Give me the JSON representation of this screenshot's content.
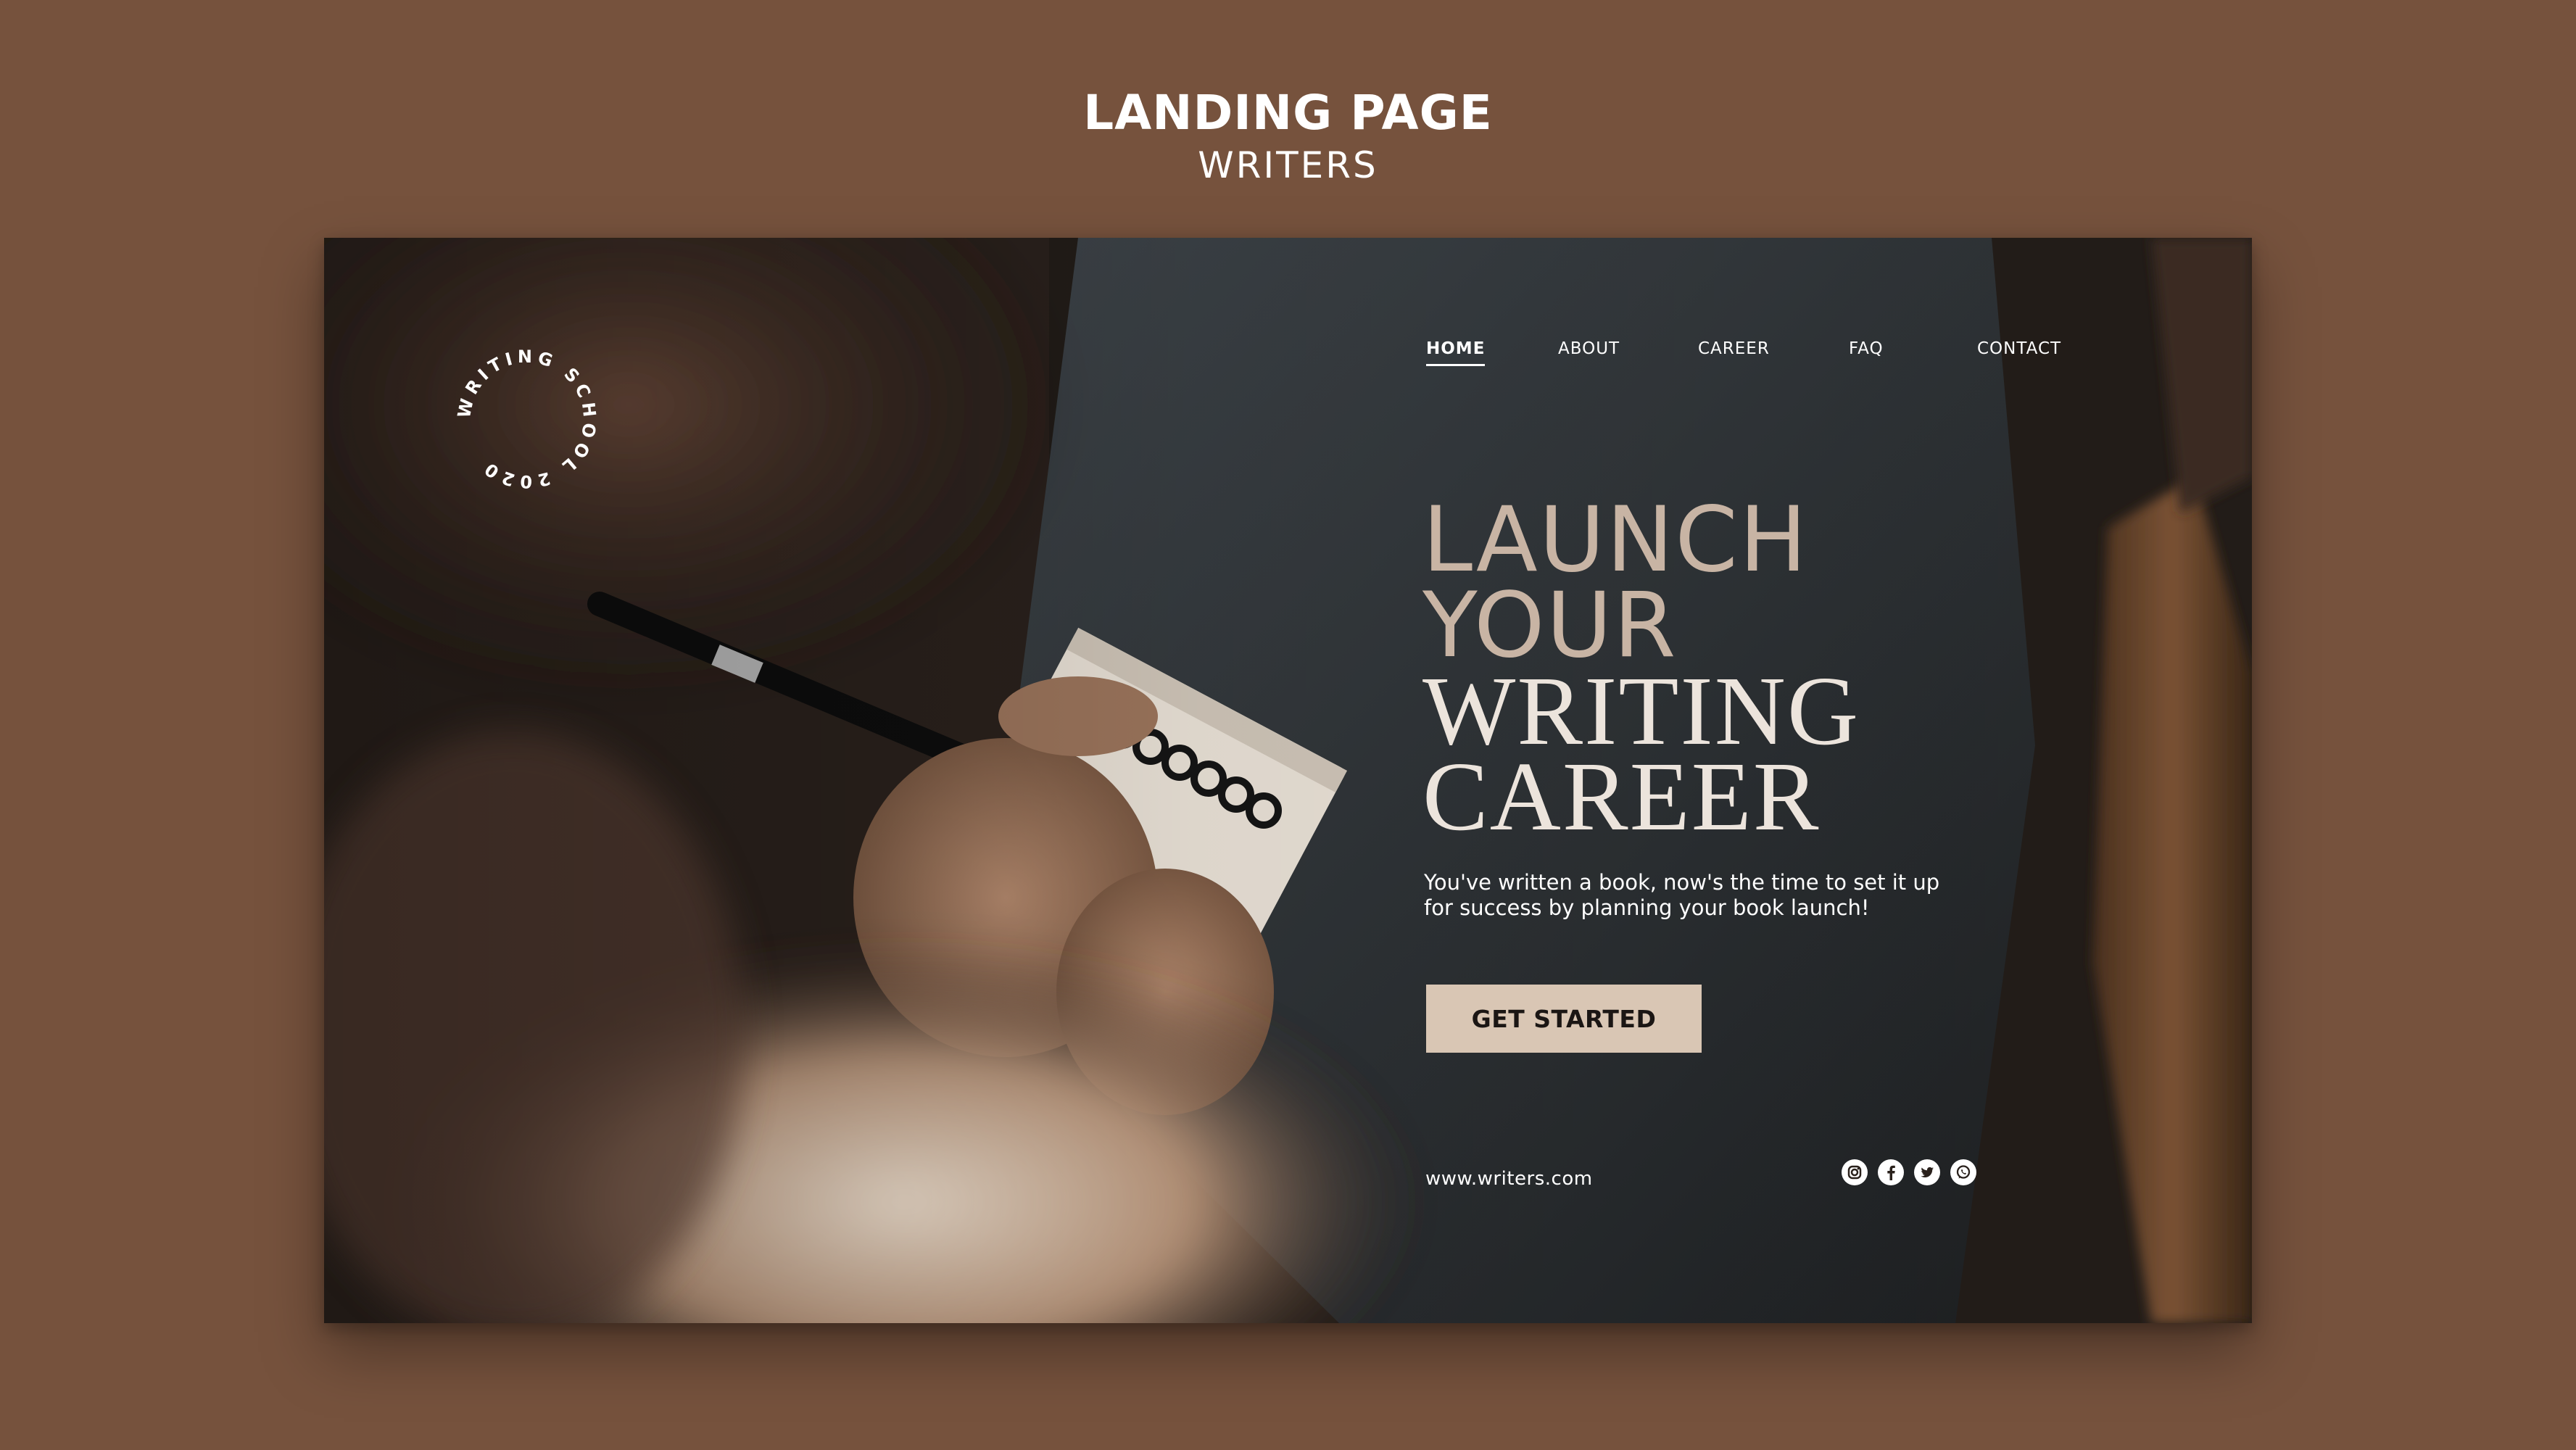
{
  "heading": {
    "title": "LANDING PAGE",
    "subtitle": "WRITERS"
  },
  "seal": {
    "text": "WRITING SCHOOL 2020"
  },
  "nav": {
    "items": [
      {
        "label": "HOME",
        "active": true
      },
      {
        "label": "ABOUT",
        "active": false
      },
      {
        "label": "CAREER",
        "active": false
      },
      {
        "label": "FAQ",
        "active": false
      },
      {
        "label": "CONTACT",
        "active": false
      }
    ]
  },
  "hero": {
    "title_line1": "LAUNCH",
    "title_line2": "YOUR",
    "title_line3": "WRITING",
    "title_line4": "CAREER",
    "subtitle_line1": "You've written a book, now's the time to set it up",
    "subtitle_line2": "for success by planning your book launch!",
    "cta_label": "GET STARTED"
  },
  "footer": {
    "url": "www.writers.com",
    "socials": [
      "instagram-icon",
      "facebook-icon",
      "twitter-icon",
      "whatsapp-icon"
    ]
  },
  "colors": {
    "background": "#76523d",
    "accent": "#d9c6b4",
    "title_light": "#c8b4a4",
    "title_bright": "#ece4dc"
  }
}
